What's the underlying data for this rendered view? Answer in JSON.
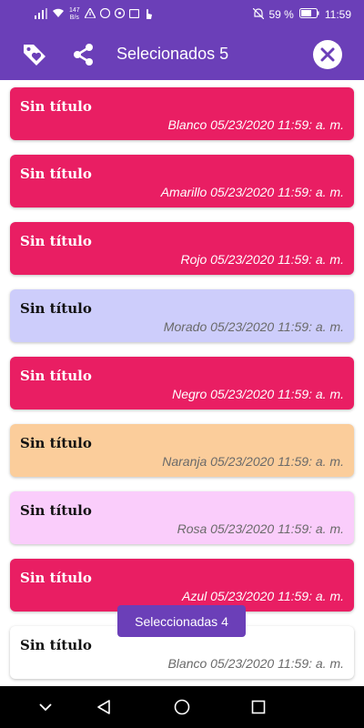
{
  "status_bar": {
    "net_speed_value": "147",
    "net_speed_unit": "B/s",
    "battery": "59 %",
    "time": "11:59"
  },
  "app_bar": {
    "title": "Selecionados 5"
  },
  "colors": {
    "primary": "#6b3fb8",
    "card_pink": "#e91e63",
    "card_lavender": "#cdcdfb",
    "card_orange": "#fbcd9b",
    "card_light_pink": "#facdfb",
    "card_white": "#ffffff"
  },
  "notes": [
    {
      "title": "Sin título",
      "meta": "Blanco 05/23/2020 11:59: a. m.",
      "color": "#e91e63"
    },
    {
      "title": "Sin título",
      "meta": "Amarillo 05/23/2020 11:59: a. m.",
      "color": "#e91e63"
    },
    {
      "title": "Sin título",
      "meta": "Rojo 05/23/2020 11:59: a. m.",
      "color": "#e91e63"
    },
    {
      "title": "Sin título",
      "meta": "Morado 05/23/2020 11:59: a. m.",
      "color": "#cdcdfb"
    },
    {
      "title": "Sin título",
      "meta": "Negro 05/23/2020 11:59: a. m.",
      "color": "#e91e63"
    },
    {
      "title": "Sin título",
      "meta": "Naranja 05/23/2020 11:59: a. m.",
      "color": "#fbcd9b"
    },
    {
      "title": "Sin título",
      "meta": "Rosa 05/23/2020 11:59: a. m.",
      "color": "#facdfb"
    },
    {
      "title": "Sin título",
      "meta": "Azul 05/23/2020 11:59: a. m.",
      "color": "#e91e63"
    },
    {
      "title": "Sin título",
      "meta": "Blanco 05/23/2020 11:59: a. m.",
      "color": "#ffffff"
    }
  ],
  "toast": {
    "text": "Seleccionadas 4"
  }
}
